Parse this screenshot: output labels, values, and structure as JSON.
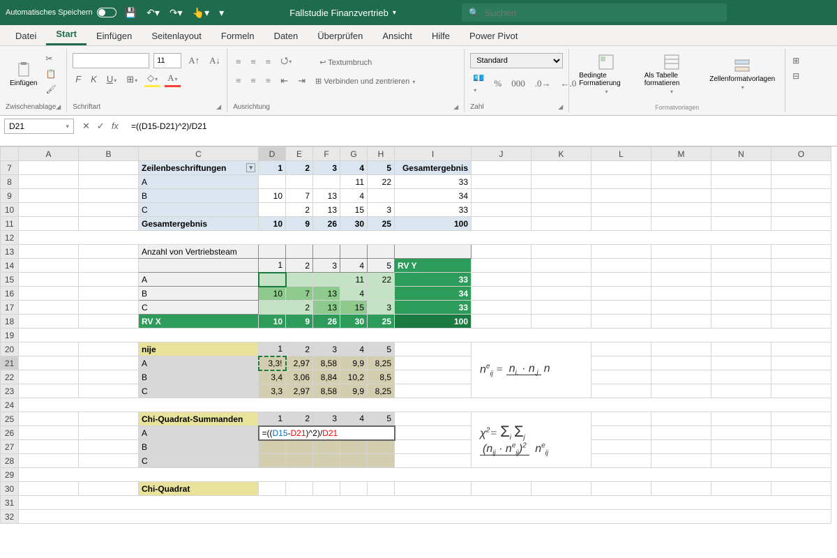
{
  "titlebar": {
    "autosave": "Automatisches Speichern",
    "doc_title": "Fallstudie Finanzvertrieb",
    "search_placeholder": "Suchen"
  },
  "tabs": [
    "Datei",
    "Start",
    "Einfügen",
    "Seitenlayout",
    "Formeln",
    "Daten",
    "Überprüfen",
    "Ansicht",
    "Hilfe",
    "Power Pivot"
  ],
  "active_tab": 1,
  "ribbon": {
    "paste_label": "Einfügen",
    "group_clipboard": "Zwischenablage",
    "font_size": "11",
    "group_font": "Schriftart",
    "wrap": "Textumbruch",
    "merge": "Verbinden und zentrieren",
    "group_align": "Ausrichtung",
    "number_format": "Standard",
    "group_number": "Zahl",
    "cond_fmt": "Bedingte Formatierung",
    "as_table": "Als Tabelle formatieren",
    "cell_styles": "Zellenformatvorlagen",
    "group_styles": "Formatvorlagen"
  },
  "formula_bar": {
    "name_box": "D21",
    "cancel": "✕",
    "confirm": "✓",
    "fx": "fx",
    "formula": "=((D15-D21)^2)/D21"
  },
  "columns": [
    "A",
    "B",
    "C",
    "D",
    "E",
    "F",
    "G",
    "H",
    "I",
    "J",
    "K",
    "L",
    "M",
    "N",
    "O"
  ],
  "rows": [
    7,
    8,
    9,
    10,
    11,
    12,
    13,
    14,
    15,
    16,
    17,
    18,
    19,
    20,
    21,
    22,
    23,
    24,
    25,
    26,
    27,
    28,
    29,
    30,
    31,
    32
  ],
  "sheet": {
    "pivot": {
      "row_label": "Zeilenbeschriftungen",
      "cols": [
        "1",
        "2",
        "3",
        "4",
        "5"
      ],
      "total_label": "Gesamtergebnis",
      "rows": [
        {
          "l": "A",
          "d": [
            "",
            "",
            "",
            "11",
            "22"
          ],
          "t": "33"
        },
        {
          "l": "B",
          "d": [
            "10",
            "7",
            "13",
            "4",
            ""
          ],
          "t": "34"
        },
        {
          "l": "C",
          "d": [
            "",
            "2",
            "13",
            "15",
            "3"
          ],
          "t": "33"
        }
      ],
      "grand_label": "Gesamtergebnis",
      "grand": [
        "10",
        "9",
        "26",
        "30",
        "25"
      ],
      "grand_total": "100"
    },
    "sec2": {
      "title": "Anzahl von Vertriebsteam",
      "cols": [
        "1",
        "2",
        "3",
        "4",
        "5"
      ],
      "rvy": "RV Y",
      "rows": [
        {
          "l": "A",
          "d": [
            "",
            "",
            "",
            "11",
            "22"
          ],
          "t": "33"
        },
        {
          "l": "B",
          "d": [
            "10",
            "7",
            "13",
            "4",
            ""
          ],
          "t": "34"
        },
        {
          "l": "C",
          "d": [
            "",
            "2",
            "13",
            "15",
            "3"
          ],
          "t": "33"
        }
      ],
      "rvx": "RV X",
      "rvx_vals": [
        "10",
        "9",
        "26",
        "30",
        "25"
      ],
      "rvx_total": "100"
    },
    "nije": {
      "title": "nije",
      "cols": [
        "1",
        "2",
        "3",
        "4",
        "5"
      ],
      "rows": [
        {
          "l": "A",
          "d": [
            "3,3!",
            "2,97",
            "8,58",
            "9,9",
            "8,25"
          ]
        },
        {
          "l": "B",
          "d": [
            "3,4",
            "3,06",
            "8,84",
            "10,2",
            "8,5"
          ]
        },
        {
          "l": "C",
          "d": [
            "3,3",
            "2,97",
            "8,58",
            "9,9",
            "8,25"
          ]
        }
      ]
    },
    "chi": {
      "title": "Chi-Quadrat-Summanden",
      "cols": [
        "1",
        "2",
        "3",
        "4",
        "5"
      ],
      "rows": [
        {
          "l": "A",
          "formula_parts": [
            "=((",
            "D15",
            "-",
            "D21",
            ")^2)/",
            "D21"
          ]
        },
        {
          "l": "B"
        },
        {
          "l": "C"
        }
      ]
    },
    "chi2_label": "Chi-Quadrat",
    "formula1": {
      "lhs_base": "n",
      "lhs_sup": "e",
      "lhs_sub": "ij",
      "top_l": "n",
      "top_l_sub": "i.",
      "top_r": "n",
      "top_r_sub": ".j",
      "bot": "n"
    },
    "formula2": {
      "chi": "χ",
      "sq": "2",
      "sum_sub_i": "i",
      "sum_sub_j": "j",
      "par_l": "(",
      "par_r": ")",
      "n1": "n",
      "n1_sub": "ij",
      "minus": "·",
      "n2": "n",
      "n2_sup": "e",
      "n2_sub": "ij",
      "pow": "2",
      "den": "n",
      "den_sup": "e",
      "den_sub": "ij"
    }
  },
  "chart_data": null
}
